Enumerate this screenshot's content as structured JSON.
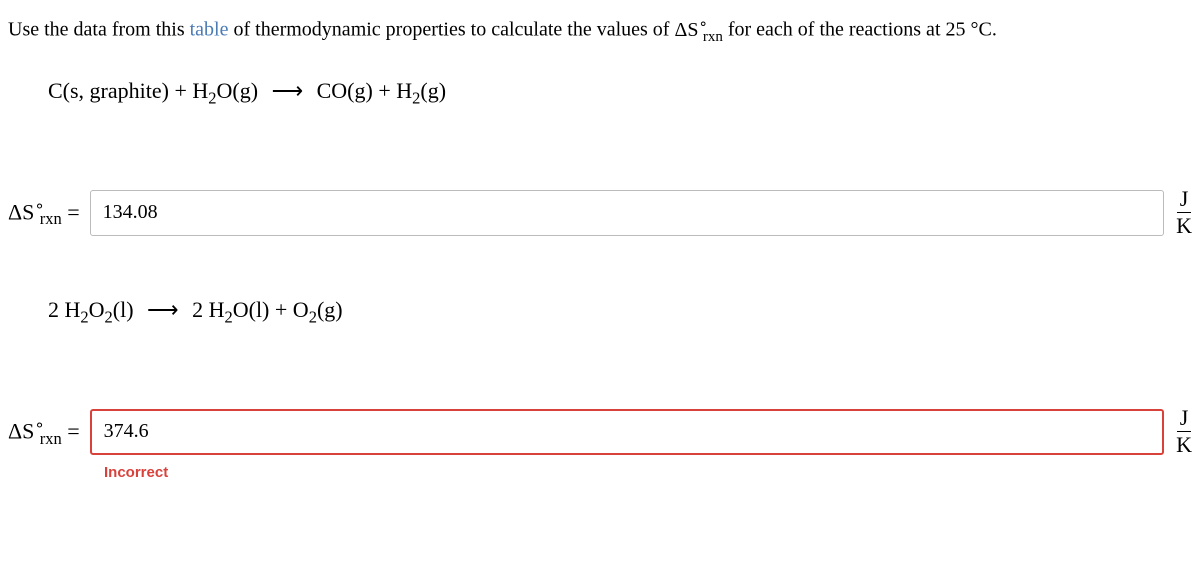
{
  "question": {
    "prefix": "Use the data from this ",
    "link_text": "table",
    "middle": " of thermodynamic properties to calculate the values of ",
    "delta_label": "ΔS",
    "delta_sub": "rxn",
    "delta_sup": "∘",
    "suffix": " for each of the reactions at 25 °C."
  },
  "part1": {
    "equation_lhs": "C(s, graphite) + H",
    "h2o_sub": "2",
    "h2o_end": "O(g)",
    "arrow": "⟶",
    "co": "CO(g) + H",
    "h2_sub": "2",
    "h2_end": "(g)",
    "label_prefix": "ΔS",
    "label_sup": "∘",
    "label_sub": "rxn",
    "equals": " =",
    "answer_value": "134.08",
    "unit_top": "J",
    "unit_bottom": "K"
  },
  "part2": {
    "coef1": "2 H",
    "sub1a": "2",
    "mid1": "O",
    "sub1b": "2",
    "state1": "(l)",
    "arrow": "⟶",
    "coef2": "2 H",
    "sub2a": "2",
    "mid2": "O(l) + O",
    "sub2b": "2",
    "state2": "(g)",
    "label_prefix": "ΔS",
    "label_sup": "∘",
    "label_sub": "rxn",
    "equals": " =",
    "answer_value": "374.6",
    "unit_top": "J",
    "unit_bottom": "K",
    "feedback": "Incorrect"
  }
}
